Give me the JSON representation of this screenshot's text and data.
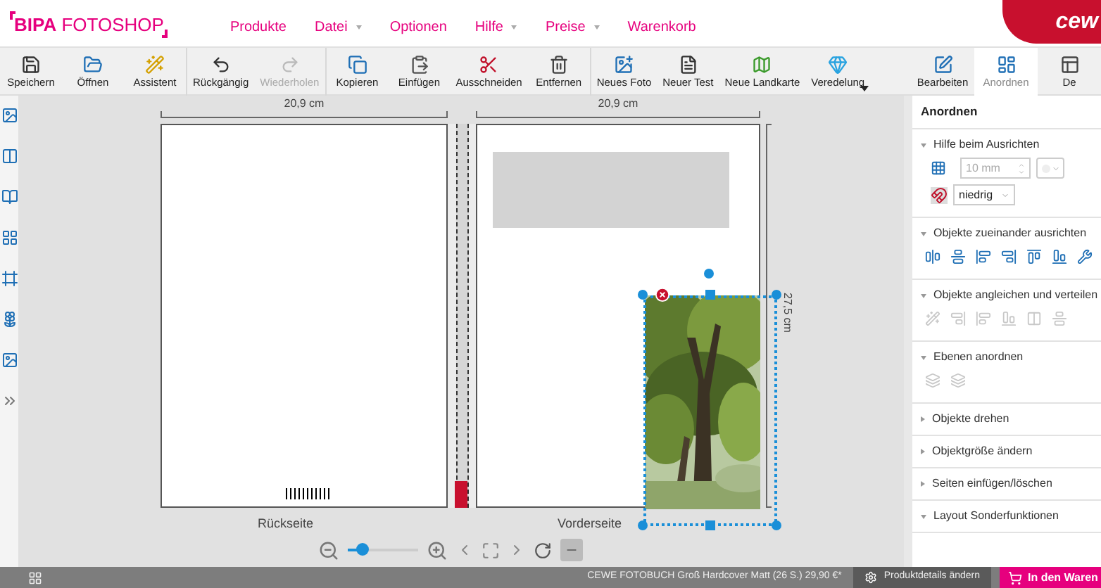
{
  "header": {
    "logo": "**BIPA** FOTOSHOP",
    "brand": "cew",
    "menu": [
      {
        "label": "Produkte",
        "dropdown": false
      },
      {
        "label": "Datei",
        "dropdown": true
      },
      {
        "label": "Optionen",
        "dropdown": false
      },
      {
        "label": "Hilfe",
        "dropdown": true
      },
      {
        "label": "Preise",
        "dropdown": true
      },
      {
        "label": "Warenkorb",
        "dropdown": false
      }
    ]
  },
  "toolbar": {
    "groups": [
      [
        {
          "label": "Speichern",
          "disabled": false
        },
        {
          "label": "Öffnen",
          "disabled": false
        },
        {
          "label": "Assistent",
          "disabled": false
        }
      ],
      [
        {
          "label": "Rückgängig",
          "disabled": false
        },
        {
          "label": "Wiederholen",
          "disabled": true
        }
      ],
      [
        {
          "label": "Kopieren",
          "disabled": false
        },
        {
          "label": "Einfügen",
          "disabled": false
        },
        {
          "label": "Ausschneiden",
          "disabled": false
        },
        {
          "label": "Entfernen",
          "disabled": false
        }
      ],
      [
        {
          "label": "Neues Foto",
          "disabled": false
        },
        {
          "label": "Neuer Test",
          "disabled": false
        },
        {
          "label": "Neue Landkarte",
          "disabled": false
        },
        {
          "label": "Veredelung",
          "disabled": false,
          "dropdown": true
        }
      ]
    ],
    "modes": [
      {
        "label": "Bearbeiten",
        "selected": false
      },
      {
        "label": "Anordnen",
        "selected": true
      },
      {
        "label": "De",
        "selected": false
      }
    ]
  },
  "canvas": {
    "widths": [
      "20,9 cm",
      "20,9 cm"
    ],
    "height": "27,5 cm",
    "pages": [
      "Rückseite",
      "Vorderseite"
    ],
    "zoom": {
      "level": 0.2
    }
  },
  "panel": {
    "title": "Anordnen",
    "sections": [
      {
        "title": "Hilfe beim Ausrichten",
        "expanded": true,
        "kind": "grid",
        "grid_size": "10 mm",
        "grid_disabled": true,
        "snap": "niedrig"
      },
      {
        "title": "Objekte zueinander ausrichten",
        "expanded": true,
        "kind": "align",
        "disabled": false
      },
      {
        "title": "Objekte angleichen und verteilen",
        "expanded": true,
        "kind": "distribute",
        "disabled": true
      },
      {
        "title": "Ebenen anordnen",
        "expanded": true,
        "kind": "layers",
        "disabled": true
      },
      {
        "title": "Objekte drehen",
        "expanded": false
      },
      {
        "title": "Objektgröße ändern",
        "expanded": false
      },
      {
        "title": "Seiten einfügen/löschen",
        "expanded": false
      },
      {
        "title": "Layout Sonderfunktionen",
        "expanded": true
      }
    ]
  },
  "status": {
    "product": "CEWE FOTOBUCH Groß Hardcover Matt (26 S.) 29,90 €*",
    "details": "Produktdetails ändern",
    "cart": "In den Waren"
  }
}
